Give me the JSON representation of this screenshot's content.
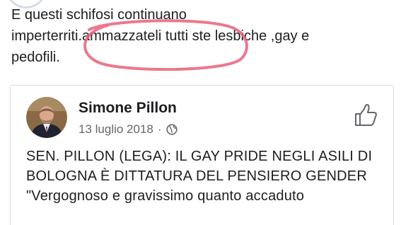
{
  "comment": {
    "text": "E questi schifosi continuano\nimperterriti.ammazzateli tutti ste lesbiche ,gay e\npedofili."
  },
  "shared_post": {
    "author_name": "Simone Pillon",
    "date": "13 luglio 2018",
    "separator": "·",
    "privacy_icon": "globe-icon",
    "like_icon": "thumbs-up-icon",
    "headline": "SEN. PILLON (LEGA): IL GAY PRIDE NEGLI ASILI DI BOLOGNA È DITTATURA DEL PENSIERO GENDER",
    "body_start": "\"Vergognoso e gravissimo quanto accaduto"
  },
  "colors": {
    "text": "#1c1e21",
    "meta": "#65676b",
    "annotation_circle": "#e8607a",
    "card_border": "#dadde1"
  }
}
